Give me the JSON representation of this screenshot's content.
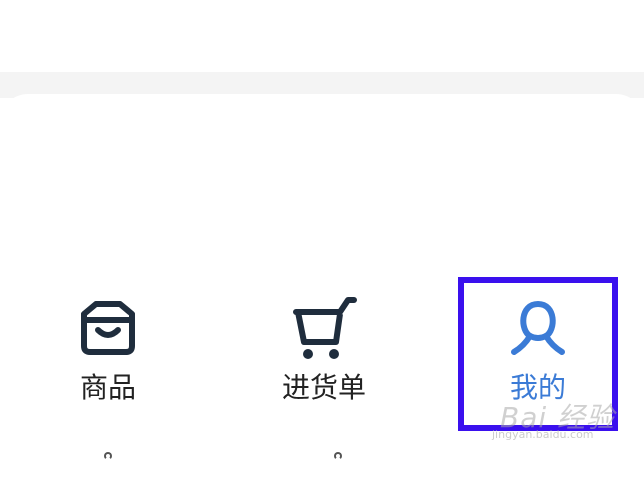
{
  "bottom_nav": {
    "items": [
      {
        "label": "商品",
        "icon": "bag-icon"
      },
      {
        "label": "进货单",
        "icon": "cart-icon"
      },
      {
        "label": "我的",
        "icon": "user-icon",
        "active": true
      }
    ],
    "active_color": "#3b7bd6",
    "highlight_color": "#3a10ee"
  },
  "watermark": {
    "text": "Bai 经验",
    "subtext": "jingyan.baidu.com"
  }
}
